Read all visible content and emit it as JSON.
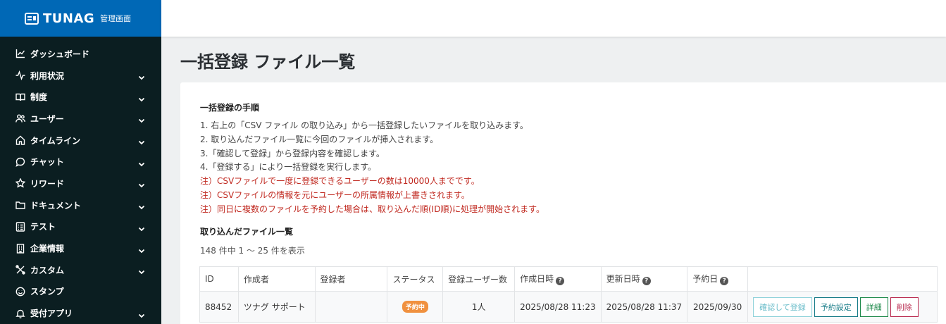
{
  "brand": {
    "name": "TUNAG",
    "subtitle": "管理画面"
  },
  "sidebar": {
    "items": [
      {
        "label": "ダッシュボード",
        "icon": "chart-line-icon",
        "expandable": false
      },
      {
        "label": "利用状況",
        "icon": "activity-icon",
        "expandable": true
      },
      {
        "label": "制度",
        "icon": "book-icon",
        "expandable": true
      },
      {
        "label": "ユーザー",
        "icon": "users-icon",
        "expandable": true
      },
      {
        "label": "タイムライン",
        "icon": "home-icon",
        "expandable": true
      },
      {
        "label": "チャット",
        "icon": "chat-icon",
        "expandable": true
      },
      {
        "label": "リワード",
        "icon": "star-icon",
        "expandable": true
      },
      {
        "label": "ドキュメント",
        "icon": "folder-icon",
        "expandable": true
      },
      {
        "label": "テスト",
        "icon": "checklist-icon",
        "expandable": true
      },
      {
        "label": "企業情報",
        "icon": "building-icon",
        "expandable": true
      },
      {
        "label": "カスタム",
        "icon": "tools-icon",
        "expandable": true
      },
      {
        "label": "スタンプ",
        "icon": "smile-icon",
        "expandable": false
      },
      {
        "label": "受付アプリ",
        "icon": "bell-icon",
        "expandable": true
      }
    ]
  },
  "page": {
    "title": "一括登録 ファイル一覧"
  },
  "instructions": {
    "heading": "一括登録の手順",
    "steps": [
      "1. 右上の「CSV ファイル の取り込み」から一括登録したいファイルを取り込みます。",
      "2. 取り込んだファイル一覧に今回のファイルが挿入されます。",
      "3.「確認して登録」から登録内容を確認します。",
      "4.「登録する」により一括登録を実行します。"
    ],
    "notes": [
      "注）CSVファイルで一度に登録できるユーザーの数は10000人までです。",
      "注）CSVファイルの情報を元にユーザーの所属情報が上書きされます。",
      "注）同日に複数のファイルを予約した場合は、取り込んだ順(ID順)に処理が開始されます。"
    ]
  },
  "files": {
    "heading": "取り込んだファイル一覧",
    "count_text": "148 件中 1 〜 25 件を表示",
    "columns": {
      "id": "ID",
      "creator": "作成者",
      "registrant": "登録者",
      "status": "ステータス",
      "user_count": "登録ユーザー数",
      "created": "作成日時",
      "updated": "更新日時",
      "scheduled": "予約日"
    },
    "rows": [
      {
        "id": "88452",
        "creator": "ツナグ サポート",
        "registrant": "",
        "status": "予約中",
        "user_count": "1人",
        "created": "2025/08/28 11:23",
        "updated": "2025/08/28 11:37",
        "scheduled": "2025/09/30",
        "actions": {
          "confirm": "確認して登録",
          "schedule": "予約設定",
          "detail": "詳細",
          "delete": "削除"
        }
      }
    ]
  },
  "colors": {
    "brand_blue": "#0068b6",
    "sidebar_bg": "#0b1e21",
    "note_red": "#c0281f",
    "badge_orange": "#f0913f",
    "teal": "#147a86"
  }
}
